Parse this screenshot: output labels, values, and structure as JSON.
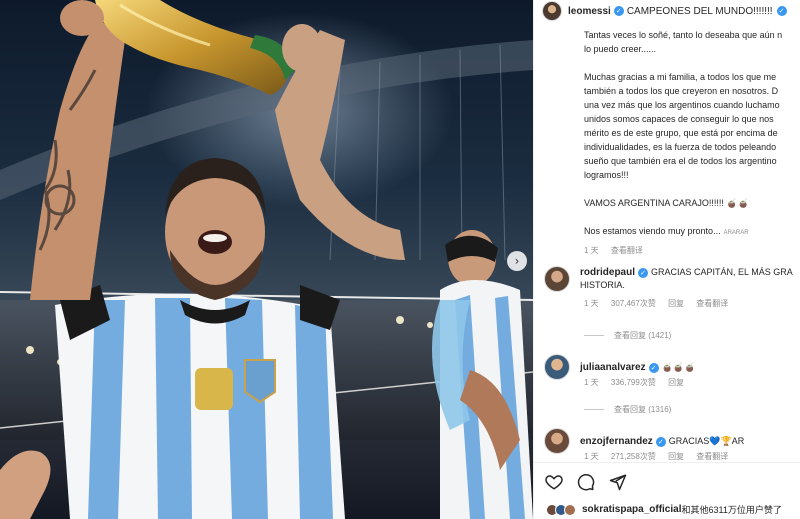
{
  "post": {
    "username": "leomessi",
    "title_text": "CAMPEONES DEL MUNDO!!!!!!!",
    "caption_lines": [
      "Tantas veces lo soñé, tanto lo deseaba que aún n",
      "lo puedo creer......",
      "",
      "Muchas gracias a mi familia, a todos los que me",
      "también a todos los que creyeron en nosotros. D",
      "una vez más que los argentinos cuando luchamo",
      "unidos somos capaces de conseguir lo que nos",
      "mérito es de este grupo, que está por encima de",
      "individualidades, es la fuerza de todos peleando",
      "sueño que también era el de todos los argentino",
      "logramos!!!",
      "",
      "VAMOS ARGENTINA CARAJO!!!!!! 🧉🧉",
      "",
      "Nos estamos viendo muy pronto..."
    ],
    "more_tag": "ARARAR",
    "time_ago": "1 天",
    "see_translation": "查看翻译"
  },
  "comments": [
    {
      "username": "rodridepaul",
      "text_line1": "GRACIAS CAPITÁN, EL MÁS GRA",
      "text_line2": "HISTORIA.",
      "time_ago": "1 天",
      "likes": "307,467次赞",
      "reply": "回复",
      "see_translation": "查看翻译",
      "view_replies": "查看回复 (1421)"
    },
    {
      "username": "juliaanalvarez",
      "text_line1": "🧉🧉🧉",
      "time_ago": "1 天",
      "likes": "336,799次赞",
      "reply": "回复",
      "view_replies": "查看回复 (1316)"
    },
    {
      "username": "enzojfernandez",
      "text_line1": "GRACIAS💙🏆AR",
      "time_ago": "1 天",
      "likes": "271,258次赞",
      "reply": "回复",
      "see_translation": "查看翻译"
    }
  ],
  "likes_summary": {
    "text_user": "sokratispapa_official",
    "text_rest": "和其他6311万位用户赞了"
  },
  "icons": {
    "like": "heart-icon",
    "comment": "comment-icon",
    "share": "share-icon",
    "next": "chevron-right-icon"
  },
  "colors": {
    "verified": "#3897f0",
    "muted": "#8e8e8e",
    "text": "#262626"
  }
}
